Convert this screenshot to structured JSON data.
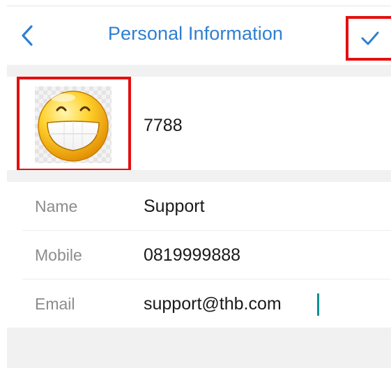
{
  "header": {
    "back_icon": "chevron-left-icon",
    "title": "Personal Information",
    "confirm_icon": "checkmark-icon",
    "accent_color": "#2f7fd1",
    "highlight_color": "#e40f0f"
  },
  "profile": {
    "avatar_icon": "grinning-smiley-icon",
    "id": "7788"
  },
  "fields": [
    {
      "label": "Name",
      "value": "Support"
    },
    {
      "label": "Mobile",
      "value": "0819999888"
    },
    {
      "label": "Email",
      "value": "support@thb.com"
    }
  ]
}
